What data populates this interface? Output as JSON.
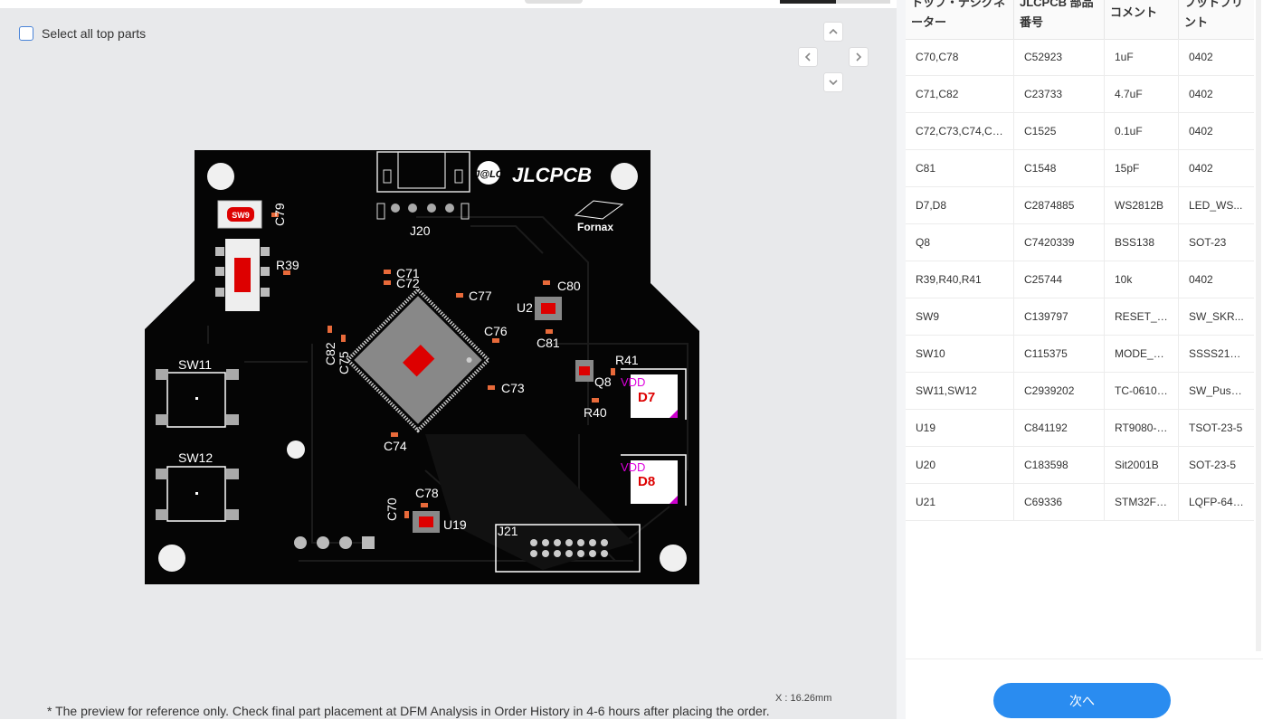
{
  "viewer": {
    "select_all_label": "Select all top parts",
    "note": "* The preview for reference only. Check final part placement at DFM Analysis in Order History in 4-6 hours after placing the order.",
    "coord_x": "X : 16.26mm"
  },
  "pcb": {
    "brand": "JLCPCB",
    "brand_badge": "J@LC",
    "logo_text": "Fornax",
    "labels": [
      "SW9",
      "C79",
      "R39",
      "J20",
      "C71",
      "C72",
      "C77",
      "C80",
      "U2",
      "C76",
      "C81",
      "C82",
      "C75",
      "R41",
      "Q8",
      "VDD",
      "D7",
      "C73",
      "R40",
      "SW11",
      "SW12",
      "C74",
      "VDD",
      "D8",
      "C78",
      "C70",
      "U19",
      "J21"
    ]
  },
  "table": {
    "headers": [
      "トップ・デジグネーター",
      "JLCPCB 部品番号",
      "コメント",
      "フットプリント"
    ],
    "rows": [
      [
        "C70,C78",
        "C52923",
        "1uF",
        "0402"
      ],
      [
        "C71,C82",
        "C23733",
        "4.7uF",
        "0402"
      ],
      [
        "C72,C73,C74,C7...",
        "C1525",
        "0.1uF",
        "0402"
      ],
      [
        "C81",
        "C1548",
        "15pF",
        "0402"
      ],
      [
        "D7,D8",
        "C2874885",
        "WS2812B",
        "LED_WS..."
      ],
      [
        "Q8",
        "C7420339",
        "BSS138",
        "SOT-23"
      ],
      [
        "R39,R40,R41",
        "C25744",
        "10k",
        "0402"
      ],
      [
        "SW9",
        "C139797",
        "RESET_S...",
        "SW_SKR..."
      ],
      [
        "SW10",
        "C115375",
        "MODE_S...",
        "SSSS213..."
      ],
      [
        "SW11,SW12",
        "C2939202",
        "TC-06104...",
        "SW_Push..."
      ],
      [
        "U19",
        "C841192",
        "RT9080-3...",
        "TSOT-23-5"
      ],
      [
        "U20",
        "C183598",
        "Sit2001B",
        "SOT-23-5"
      ],
      [
        "U21",
        "C69336",
        "STM32F4...",
        "LQFP-64_..."
      ]
    ]
  },
  "footer": {
    "next_label": "次へ"
  }
}
